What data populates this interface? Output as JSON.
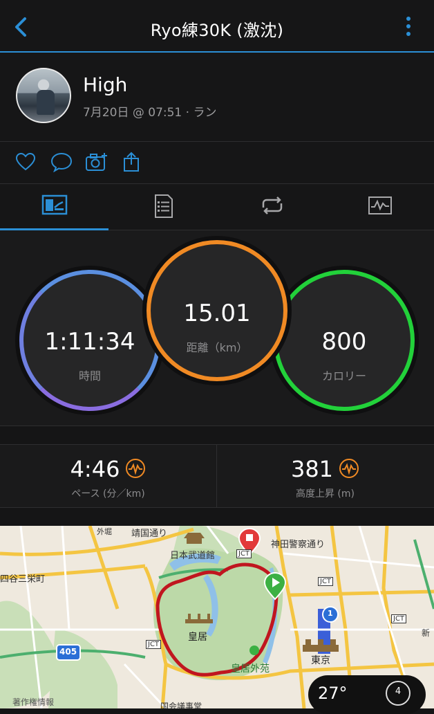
{
  "header": {
    "title": "Ryo練30K (激沈)"
  },
  "activity": {
    "name": "High",
    "meta": "7月20日 @ 07:51 · ラン"
  },
  "stats": {
    "time": {
      "value": "1:11:34",
      "label": "時間"
    },
    "distance": {
      "value": "15.01",
      "label": "距離（km）"
    },
    "calories": {
      "value": "800",
      "label": "カロリー"
    }
  },
  "metrics": {
    "pace": {
      "value": "4:46",
      "label": "ペース (分／km)"
    },
    "elevation": {
      "value": "381",
      "label": "高度上昇 (m)"
    }
  },
  "map": {
    "labels": {
      "yasukuni": "靖国通り",
      "budokan": "日本武道館",
      "jimbocho": "神田警察通り",
      "yotsuya": "四谷三栄町",
      "jct1": "JCT",
      "jct2": "JCT",
      "jct3": "JCT",
      "jct4": "JCT",
      "kokyo": "皇居",
      "gaien": "皇居外苑",
      "tokyo": "東京",
      "route405": "405",
      "route1": "1",
      "copyright": "著作権情報",
      "gaika": "外堀",
      "shin": "新",
      "kokkai": "国会議事堂"
    }
  },
  "weather": {
    "temp": "27°",
    "wind": "4"
  },
  "colors": {
    "accent": "#2b8fd6",
    "time_ring": "#5b8fe0",
    "distance_ring": "#f08a24",
    "calorie_ring": "#22d13a",
    "route": "#c0161f"
  }
}
